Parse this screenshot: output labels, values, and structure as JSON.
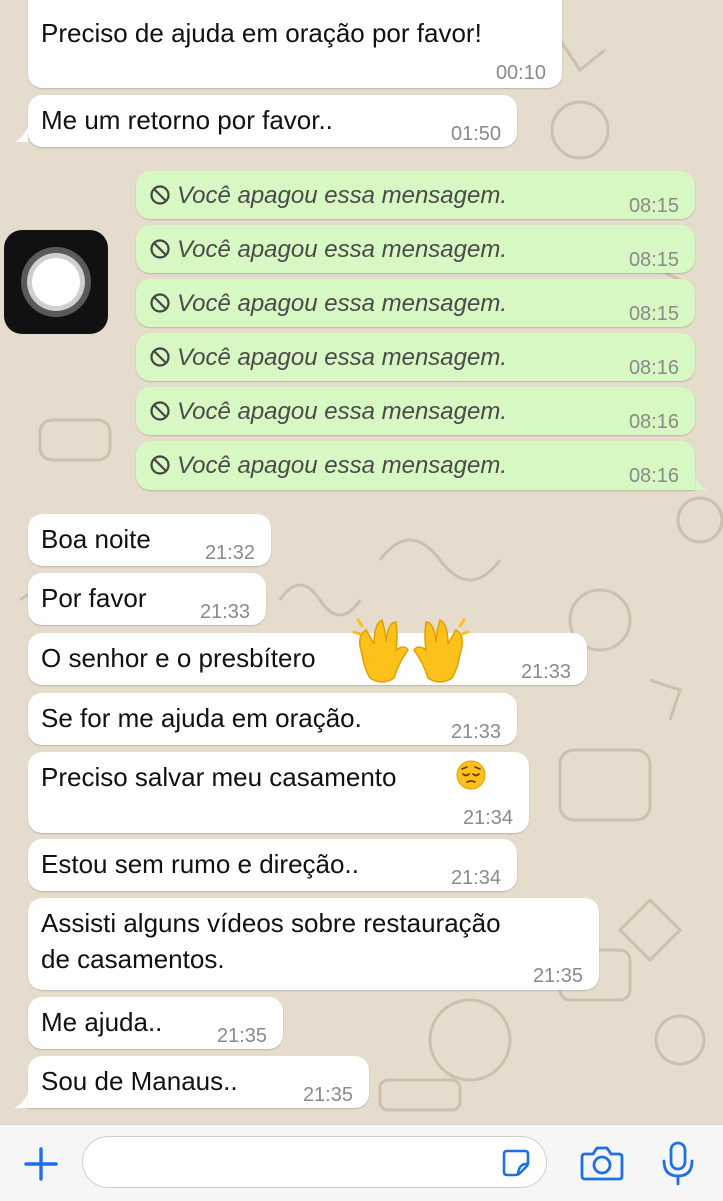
{
  "colors": {
    "accent": "#1f6fe5",
    "incoming_bubble": "#ffffff",
    "outgoing_bubble": "#d7f8c2",
    "timestamp": "#8a8a8a"
  },
  "messages": [
    {
      "id": "m1",
      "dir": "in",
      "text": "Preciso de ajuda em oração por favor!",
      "time": "00:10"
    },
    {
      "id": "m2",
      "dir": "in",
      "text": "Me um retorno por favor..",
      "time": "01:50"
    },
    {
      "id": "m3",
      "dir": "out",
      "deleted": true,
      "text": "Você apagou essa mensagem.",
      "time": "08:15"
    },
    {
      "id": "m4",
      "dir": "out",
      "deleted": true,
      "text": "Você apagou essa mensagem.",
      "time": "08:15"
    },
    {
      "id": "m5",
      "dir": "out",
      "deleted": true,
      "text": "Você apagou essa mensagem.",
      "time": "08:15"
    },
    {
      "id": "m6",
      "dir": "out",
      "deleted": true,
      "text": "Você apagou essa mensagem.",
      "time": "08:16"
    },
    {
      "id": "m7",
      "dir": "out",
      "deleted": true,
      "text": "Você apagou essa mensagem.",
      "time": "08:16"
    },
    {
      "id": "m8",
      "dir": "out",
      "deleted": true,
      "text": "Você apagou essa mensagem.",
      "time": "08:16"
    },
    {
      "id": "m9",
      "dir": "in",
      "text": "Boa noite",
      "time": "21:32"
    },
    {
      "id": "m10",
      "dir": "in",
      "text": "Por favor",
      "time": "21:33"
    },
    {
      "id": "m11",
      "dir": "in",
      "text": "O senhor e o presbítero",
      "emoji": "raising-hands",
      "time": "21:33"
    },
    {
      "id": "m12",
      "dir": "in",
      "text": "Se for me ajuda em oração.",
      "time": "21:33"
    },
    {
      "id": "m13",
      "dir": "in",
      "text": "Preciso salvar meu casamento",
      "emoji": "pensive-face",
      "time": "21:34"
    },
    {
      "id": "m14",
      "dir": "in",
      "text": "Estou sem rumo e direção..",
      "time": "21:34"
    },
    {
      "id": "m15",
      "dir": "in",
      "text_line1": "Assisti alguns vídeos sobre restauração",
      "text_line2": "de casamentos.",
      "time": "21:35"
    },
    {
      "id": "m16",
      "dir": "in",
      "text": "Me ajuda..",
      "time": "21:35"
    },
    {
      "id": "m17",
      "dir": "in",
      "text": "Sou de Manaus..",
      "time": "21:35"
    }
  ],
  "composer": {
    "placeholder": "",
    "icons": [
      "plus-icon",
      "sticker-icon",
      "camera-icon",
      "microphone-icon"
    ]
  },
  "overlay": {
    "icon": "assistive-touch-button"
  }
}
